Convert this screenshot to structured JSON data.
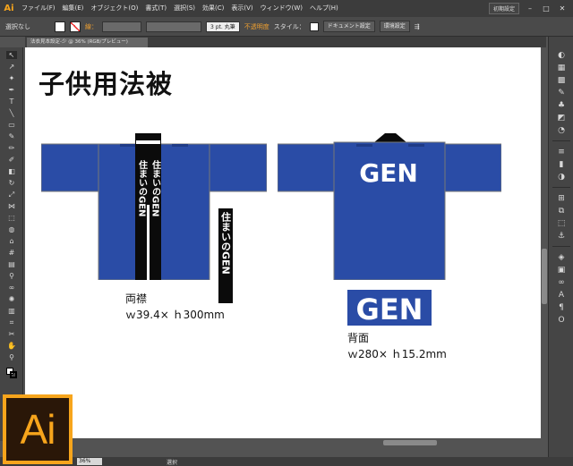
{
  "app": {
    "logo": "Ai"
  },
  "menubar": {
    "items": [
      "ファイル(F)",
      "編集(E)",
      "オブジェクト(O)",
      "書式(T)",
      "選択(S)",
      "効果(C)",
      "表示(V)",
      "ウィンドウ(W)",
      "ヘルプ(H)"
    ],
    "workspace": "初期設定"
  },
  "control_bar": {
    "selection": "選択なし",
    "stroke_label": "線：",
    "stroke_weight": "3 pt. 丸筆",
    "opacity_label": "不透明度",
    "style_label": "スタイル：",
    "document_settings": "ドキュメント設定",
    "preferences": "環境設定"
  },
  "document_tab": {
    "label": "法衣見本設定-少 @ 36% (RGB/プレビュー)"
  },
  "canvas": {
    "title": "子供用法被",
    "front_jacket": {
      "collar_text": [
        "住まいのGEN",
        "住まいのGEN"
      ]
    },
    "collar_strip": {
      "text": "住まいのGEN"
    },
    "back_jacket": {
      "logo": "GEN"
    },
    "back_print": {
      "logo": "GEN"
    },
    "collar_caption": {
      "title": "両襟",
      "size": "ｗ39.4× ｈ300mm"
    },
    "back_caption": {
      "title": "背面",
      "size": "ｗ280× ｈ15.2mm"
    }
  },
  "colors": {
    "jacket_blue": "#2a4ca6",
    "jacket_dark": "#1f3b86",
    "collar_black": "#0b0b0b",
    "ai_orange": "#f7a51c"
  },
  "status": {
    "zoom": "36%",
    "tool": "選択"
  }
}
